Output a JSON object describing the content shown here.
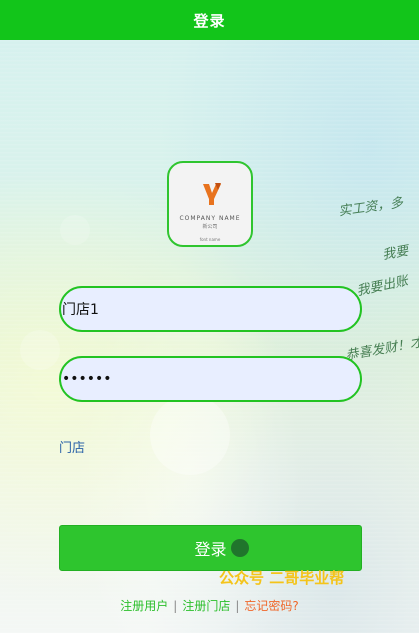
{
  "header": {
    "title": "登录"
  },
  "background": {
    "handwriting": [
      "实工资，多",
      "我要",
      "我要出账",
      "恭喜发财！才"
    ]
  },
  "logo": {
    "company_name": "COMPANY NAME",
    "company_sub": "新公司",
    "footer": "font name",
    "mark_color": "#e8731e"
  },
  "form": {
    "username_value": "门店1",
    "password_value": "123456",
    "store_link": "门店"
  },
  "actions": {
    "login_label": "登录"
  },
  "watermark": {
    "text": "公众号 二哥毕业帮"
  },
  "footer": {
    "register_user": "注册用户",
    "register_store": "注册门店",
    "forgot_password": "忘记密码?",
    "separator": "|"
  },
  "colors": {
    "accent": "#12c51a",
    "button": "#2ec52e",
    "link_blue": "#2a62a8",
    "forgot_orange": "#f0672a",
    "watermark": "#f4c41a"
  }
}
